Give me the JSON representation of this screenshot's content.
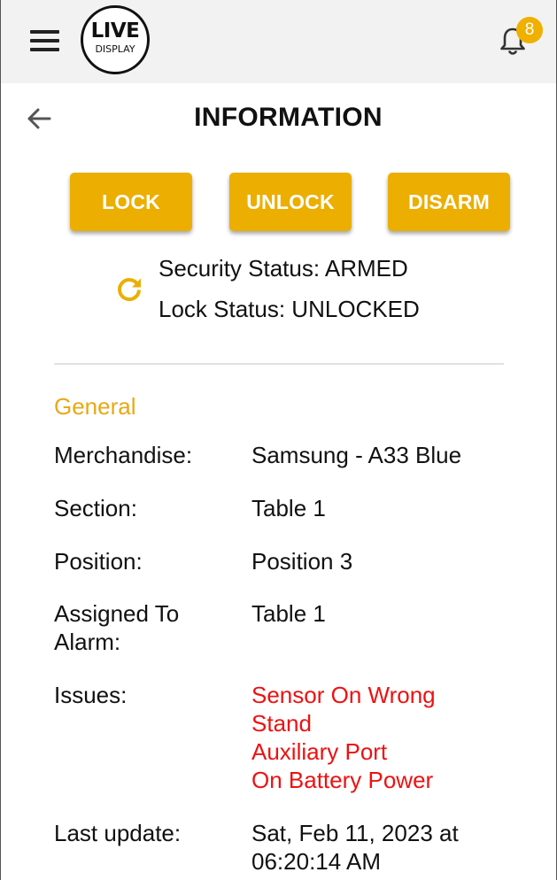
{
  "topbar": {
    "logo": {
      "line1": "LIVE",
      "line2": "DISPLAY"
    },
    "notifications": {
      "count": "8",
      "badge_color": "#f0b000"
    }
  },
  "page": {
    "title": "INFORMATION"
  },
  "actions": {
    "lock": "LOCK",
    "unlock": "UNLOCK",
    "disarm": "DISARM",
    "button_color": "#ecae00"
  },
  "status": {
    "security": "Security Status: ARMED",
    "lock": "Lock Status: UNLOCKED"
  },
  "general": {
    "title": "General",
    "rows": [
      {
        "label": "Merchandise:",
        "value": "Samsung - A33 Blue"
      },
      {
        "label": "Section:",
        "value": "Table 1"
      },
      {
        "label": "Position:",
        "value": "Position 3"
      },
      {
        "label": "Assigned To Alarm:",
        "value": "Table 1"
      },
      {
        "label": "Issues:",
        "values": [
          "Sensor On Wrong Stand",
          "Auxiliary Port",
          "On Battery Power"
        ]
      },
      {
        "label": "Last update:",
        "value": "Sat, Feb 11, 2023 at 06:20:14 AM"
      }
    ]
  },
  "colors": {
    "accent": "#e8a817",
    "issue_text": "#ee1111"
  },
  "icons": {
    "menu": "hamburger-menu-icon",
    "notifications": "bell-icon",
    "back": "arrow-back-icon",
    "refresh": "refresh-icon"
  }
}
